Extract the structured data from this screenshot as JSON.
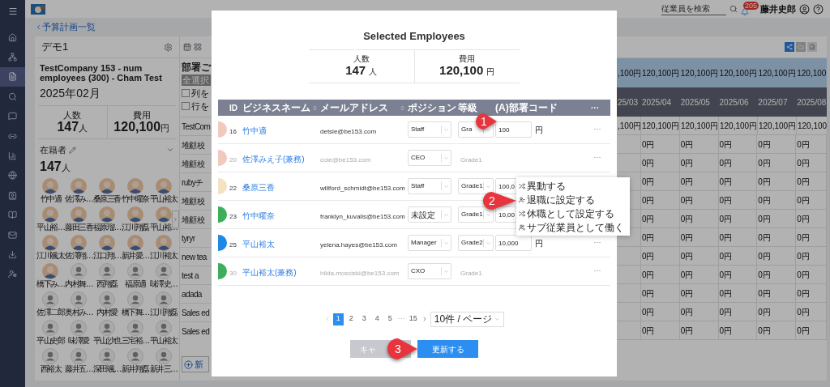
{
  "top_bar": {
    "search_placeholder": "従業員を検索",
    "notification_badge": "205",
    "user_name": "藤井史郎"
  },
  "sidebar": {
    "items": [
      {
        "selected": false
      },
      {
        "selected": false
      },
      {
        "selected": true
      },
      {
        "selected": false
      },
      {
        "selected": false
      },
      {
        "selected": false
      },
      {
        "selected": false
      },
      {
        "selected": false
      },
      {
        "selected": false
      },
      {
        "selected": false
      },
      {
        "selected": false
      },
      {
        "selected": false
      },
      {
        "selected": false
      }
    ]
  },
  "back_link": "予算計画一覧",
  "plan_card": {
    "title": "デモ1",
    "company": "TestCompany 153 - num employees (300) - Cham Test",
    "month": "2025年02月",
    "stats": [
      {
        "label": "人数",
        "value": "147",
        "unit": "人"
      },
      {
        "label": "費用",
        "value": "120,100",
        "unit": "円"
      }
    ],
    "roster": {
      "label": "在籍者",
      "count": "147",
      "unit": "人",
      "members": [
        {
          "name": "竹中適",
          "kind": "illustrated"
        },
        {
          "name": "佐澤み…",
          "kind": "illustrated"
        },
        {
          "name": "桑原三香",
          "kind": "illustrated"
        },
        {
          "name": "竹中曜奈",
          "kind": "illustrated"
        },
        {
          "name": "平山裕太",
          "kind": "illustrated"
        },
        {
          "name": "平山裕…",
          "kind": "illustrated"
        },
        {
          "name": "藤田三香",
          "kind": "illustrated"
        },
        {
          "name": "福原瑠…",
          "kind": "illustrated"
        },
        {
          "name": "江川翔磊",
          "kind": "illustrated"
        },
        {
          "name": "平山裕…",
          "kind": "illustrated"
        },
        {
          "name": "江川颯太",
          "kind": "illustrated"
        },
        {
          "name": "佐澤翔…",
          "kind": "illustrated"
        },
        {
          "name": "江口翔…",
          "kind": "illustrated"
        },
        {
          "name": "新井愛…",
          "kind": "illustrated"
        },
        {
          "name": "江川裕太",
          "kind": "illustrated"
        },
        {
          "name": "橋下み…",
          "kind": "illustrated"
        },
        {
          "name": "内村舞…",
          "kind": "default"
        },
        {
          "name": "西翔磊",
          "kind": "default"
        },
        {
          "name": "福原適",
          "kind": "default"
        },
        {
          "name": "味澤史…",
          "kind": "default"
        },
        {
          "name": "佐澤二郎",
          "kind": "default"
        },
        {
          "name": "奥村み…",
          "kind": "default"
        },
        {
          "name": "内村愛",
          "kind": "default"
        },
        {
          "name": "橋下舞…",
          "kind": "default"
        },
        {
          "name": "江川翔磊",
          "kind": "default"
        },
        {
          "name": "平山史郎",
          "kind": "default"
        },
        {
          "name": "味澤愛",
          "kind": "default"
        },
        {
          "name": "平山沙也",
          "kind": "default"
        },
        {
          "name": "三宅裕…",
          "kind": "default"
        },
        {
          "name": "平山裕太",
          "kind": "default"
        },
        {
          "name": "西裕太",
          "kind": "default"
        },
        {
          "name": "藤井五…",
          "kind": "default"
        },
        {
          "name": "深田颯…",
          "kind": "default"
        },
        {
          "name": "新井翔磊",
          "kind": "default"
        },
        {
          "name": "新井三…",
          "kind": "default"
        }
      ]
    }
  },
  "department_panel": {
    "title": "部署ご",
    "select_all": "全選択",
    "options": [
      {
        "label": "列を",
        "checked": false
      },
      {
        "label": "行を",
        "checked": false
      }
    ],
    "rows": [
      "TestCom",
      "堆顧校",
      "堆顧校",
      "rubyチ",
      "堆顧校",
      "堆顧校",
      "tyryr",
      "new tea",
      "test a",
      "adada",
      "Sales ed",
      "Sales ed"
    ],
    "new_button": "新"
  },
  "budget_table": {
    "summary": [
      ",100円",
      "120,100円",
      "120,100円",
      "120,100円",
      "120,100円",
      "120,100"
    ],
    "months": [
      "25/03",
      "2025/04",
      "2025/05",
      "2025/06",
      "2025/07",
      "2025/08"
    ],
    "rows": [
      [
        ",100円",
        "120,100円",
        "120,100円",
        "120,100円",
        "120,100円",
        "120,100"
      ],
      [
        "",
        "0円",
        "0円",
        "0円",
        "0円",
        "0円"
      ],
      [
        "",
        "0円",
        "0円",
        "0円",
        "0円",
        "0円"
      ],
      [
        "",
        "0円",
        "0円",
        "0円",
        "0円",
        "0円"
      ],
      [
        "",
        "0円",
        "0円",
        "0円",
        "0円",
        "0円"
      ],
      [
        "",
        "0円",
        "0円",
        "0円",
        "0円",
        "0円"
      ],
      [
        "",
        "0円",
        "0円",
        "0円",
        "0円",
        "0円"
      ],
      [
        "",
        "0円",
        "0円",
        "0円",
        "0円",
        "0円"
      ],
      [
        "",
        "0円",
        "0円",
        "0円",
        "0円",
        "0円"
      ],
      [
        "",
        "0円",
        "0円",
        "0円",
        "0円",
        "0円"
      ],
      [
        "",
        "0円",
        "0円",
        "0円",
        "0円",
        "0円"
      ],
      [
        "",
        "0円",
        "0円",
        "0円",
        "0円",
        "0円"
      ]
    ]
  },
  "modal": {
    "title": "Selected Employees",
    "stats": [
      {
        "label": "人数",
        "value": "147",
        "unit": "人"
      },
      {
        "label": "費用",
        "value": "120,100",
        "unit": "円"
      }
    ],
    "columns": [
      "ID",
      "ビジネスネーム",
      "メールアドレス",
      "ポジション",
      "等級",
      "(A)部署コード",
      "···"
    ],
    "rows": [
      {
        "kind": "primary",
        "color": "#f2c9c0",
        "id": "16",
        "name": "竹中適",
        "email": "detsle@be153.com",
        "position": "Staff",
        "grade": "Gra",
        "code": "100",
        "unit": "円",
        "more": "···"
      },
      {
        "kind": "concurrent",
        "color": "#f2c9c0",
        "id": "20",
        "name": "佐澤みえ子(兼務)",
        "email": "cole@be153.com",
        "position": "CEO",
        "grade": "Grade1",
        "more": "···"
      },
      {
        "kind": "primary",
        "color": "#f3e3c3",
        "id": "22",
        "name": "桑原三香",
        "email": "willford_schmidt@be153.com",
        "position": "Staff",
        "grade": "Grade1",
        "code": "100,0"
      },
      {
        "kind": "primary",
        "color": "#3fae5a",
        "id": "23",
        "name": "竹中曜奈",
        "email": "franklyn_kuvalis@be153.com",
        "position": "未設定",
        "grade": "Grade1",
        "code": "10,00"
      },
      {
        "kind": "primary",
        "color": "#1e88e5",
        "id": "25",
        "name": "平山裕太",
        "email": "yelena.hayes@be153.com",
        "position": "Manager",
        "grade": "Grade2",
        "code": "10,000",
        "unit": "円",
        "more": "···"
      },
      {
        "kind": "concurrent",
        "color": "#3fae5a",
        "id": "30",
        "name": "平山裕太(兼務)",
        "email": "hilda.mosciski@be153.com",
        "position": "CXO",
        "grade": "Grade1",
        "more": "···"
      }
    ],
    "pagination": {
      "pages": [
        {
          "label": "1",
          "kind": "page",
          "selected": true
        },
        {
          "label": "2",
          "kind": "page",
          "selected": false
        },
        {
          "label": "3",
          "kind": "page",
          "selected": false
        },
        {
          "label": "4",
          "kind": "page",
          "selected": false
        },
        {
          "label": "5",
          "kind": "page",
          "selected": false
        },
        {
          "label": "···",
          "kind": "ellipsis"
        },
        {
          "label": "15",
          "kind": "page",
          "selected": false
        }
      ],
      "page_size": "10件 / ページ"
    },
    "cancel_button": "キャ",
    "submit_button": "更新する",
    "context_menu": [
      "異動する",
      "退職に設定する",
      "休職として設定する",
      "サブ従業員として働く"
    ]
  },
  "callouts": [
    "1",
    "2",
    "3"
  ]
}
